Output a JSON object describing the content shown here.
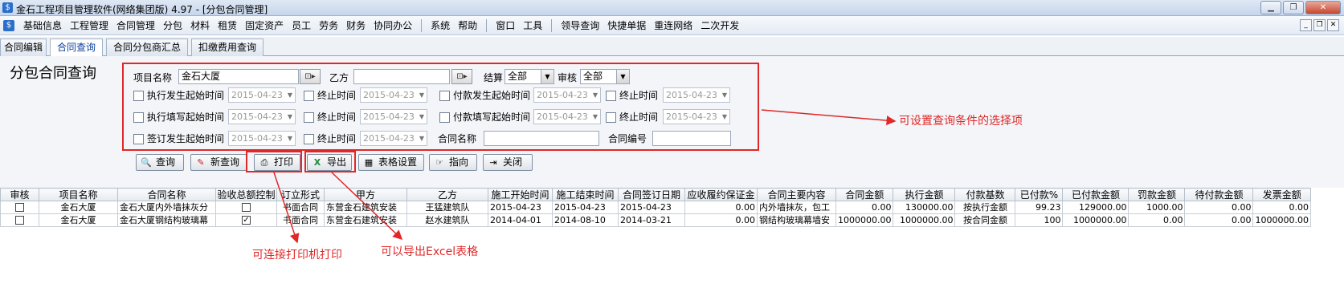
{
  "window": {
    "title": "金石工程项目管理软件(网络集团版) 4.97 - [分包合同管理]",
    "app_icon": "app-logo-icon"
  },
  "menubar": {
    "items": [
      "基础信息",
      "工程管理",
      "合同管理",
      "分包",
      "材料",
      "租赁",
      "固定资产",
      "员工",
      "劳务",
      "财务",
      "协同办公",
      "|",
      "系统",
      "帮助",
      "|",
      "窗口",
      "工具",
      "|",
      "领导查询",
      "快捷单据",
      "重连网络",
      "二次开发"
    ]
  },
  "tabs": [
    "合同编辑",
    "合同查询",
    "合同分包商汇总",
    "扣缴费用查询"
  ],
  "active_tab": "合同查询",
  "page_title": "分包合同查询",
  "filters": {
    "project_name_label": "项目名称",
    "project_name_value": "金石大厦",
    "party_b_label": "乙方",
    "party_b_value": "",
    "settle_label": "结算",
    "settle_value": "全部",
    "audit_label": "审核",
    "audit_value": "全部",
    "row2": {
      "a": "执行发生起始时间",
      "a_date": "2015-04-23",
      "b": "终止时间",
      "b_date": "2015-04-23",
      "c": "付款发生起始时间",
      "c_date": "2015-04-23",
      "d": "终止时间",
      "d_date": "2015-04-23"
    },
    "row3": {
      "a": "执行填写起始时间",
      "a_date": "2015-04-23",
      "b": "终止时间",
      "b_date": "2015-04-23",
      "c": "付款填写起始时间",
      "c_date": "2015-04-23",
      "d": "终止时间",
      "d_date": "2015-04-23"
    },
    "row4": {
      "a": "签订发生起始时间",
      "a_date": "2015-04-23",
      "b": "终止时间",
      "b_date": "2015-04-23",
      "contract_name_label": "合同名称",
      "contract_no_label": "合同编号"
    }
  },
  "buttons": {
    "query": "查询",
    "new_query": "新查询",
    "print": "打印",
    "export": "导出",
    "table_settings": "表格设置",
    "pointer": "指向",
    "close": "关闭"
  },
  "table": {
    "columns": [
      "审核",
      "项目名称",
      "合同名称",
      "验收总额控制",
      "订立形式",
      "甲方",
      "乙方",
      "施工开始时间",
      "施工结束时间",
      "合同签订日期",
      "应收履约保证金",
      "合同主要内容",
      "合同金额",
      "执行金额",
      "付款基数",
      "已付款%",
      "已付款金额",
      "罚款金额",
      "待付款金额",
      "发票金额"
    ],
    "rows": [
      {
        "audit": false,
        "project": "金石大厦",
        "contract": "金石大厦内外墙抹灰分",
        "control": false,
        "form": "书面合同",
        "party_a": "东营金石建筑安装",
        "party_b": "王猛建筑队",
        "start": "2015-04-23",
        "end": "2015-04-23",
        "signed": "2015-04-23",
        "deposit": "0.00",
        "content": "内外墙抹灰，包工",
        "amount": "0.00",
        "exec": "130000.00",
        "basis": "按执行金额",
        "paid_pct": "99.23",
        "paid": "129000.00",
        "fine": "1000.00",
        "pending": "0.00",
        "invoice": "0.00"
      },
      {
        "audit": false,
        "project": "金石大厦",
        "contract": "金石大厦钢结构玻璃幕",
        "control": true,
        "form": "书面合同",
        "party_a": "东营金石建筑安装",
        "party_b": "赵水建筑队",
        "start": "2014-04-01",
        "end": "2014-08-10",
        "signed": "2014-03-21",
        "deposit": "0.00",
        "content": "钢结构玻璃幕墙安",
        "amount": "1000000.00",
        "exec": "1000000.00",
        "basis": "按合同金额",
        "paid_pct": "100",
        "paid": "1000000.00",
        "fine": "0.00",
        "pending": "0.00",
        "invoice": "1000000.00"
      }
    ]
  },
  "annotations": {
    "query_conditions": "可设置查询条件的选择项",
    "print_note": "可连接打印机打印",
    "export_note": "可以导出Excel表格",
    "color": "#e02828"
  }
}
